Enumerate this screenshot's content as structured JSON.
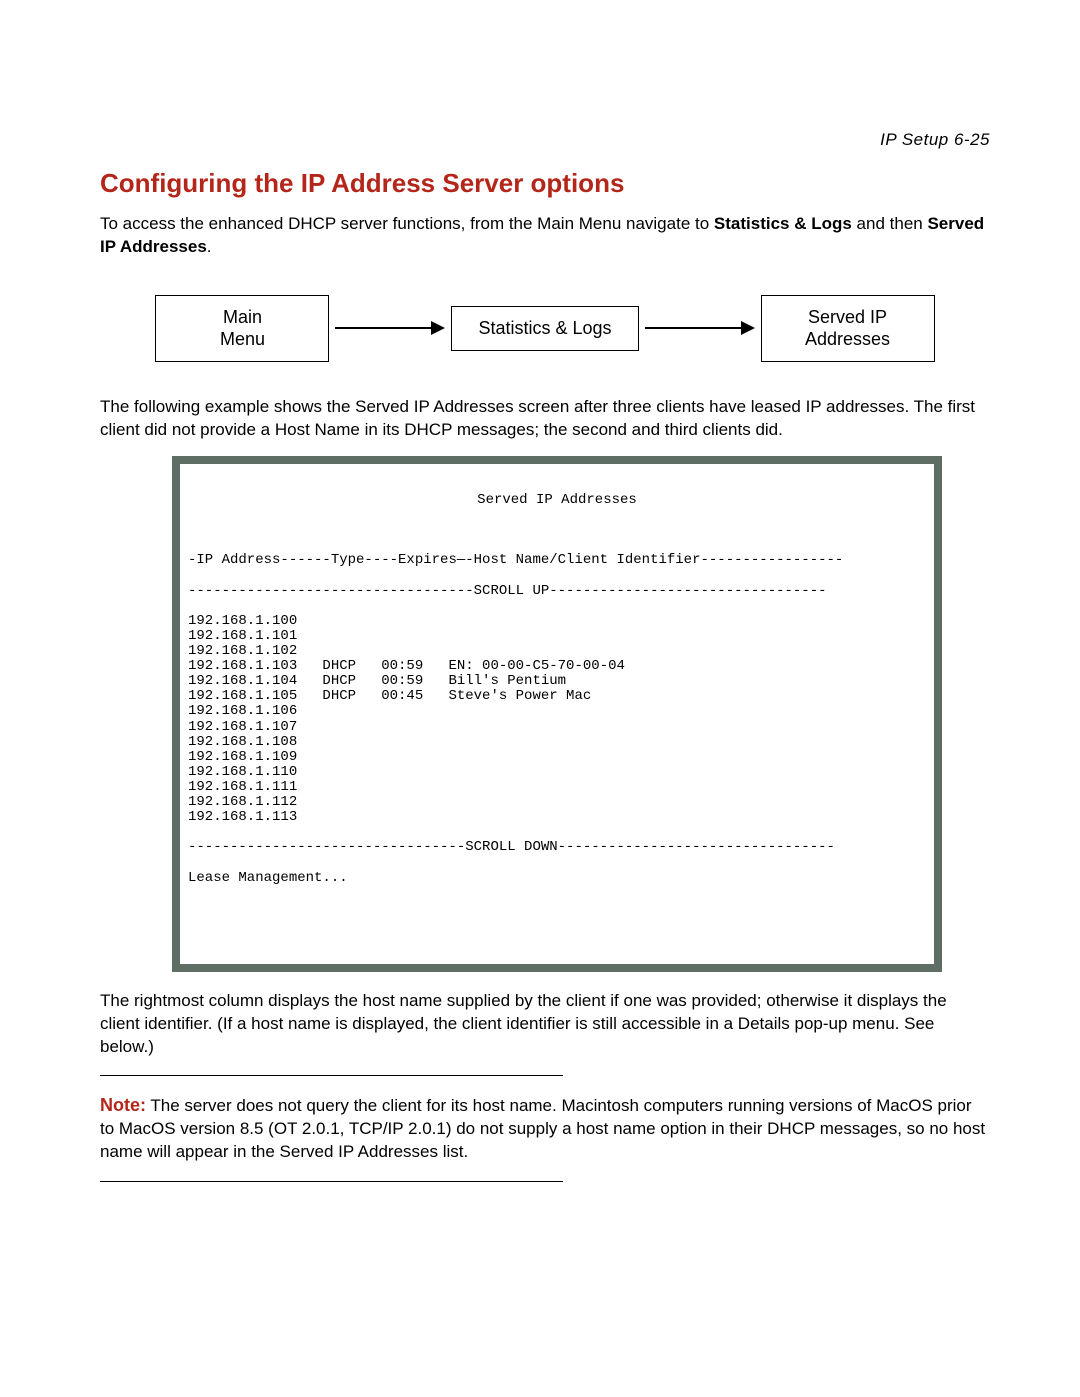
{
  "header": {
    "running_head": "IP Setup   6-25"
  },
  "title": "Configuring the IP Address Server options",
  "intro": {
    "pre": "To access the enhanced DHCP server functions, from the Main Menu navigate to ",
    "bold1": "Statistics & Logs",
    "mid": " and then ",
    "bold2": "Served IP Addresses",
    "post": "."
  },
  "breadcrumb": {
    "box1_line1": "Main",
    "box1_line2": "Menu",
    "box2": "Statistics & Logs",
    "box3_line1": "Served IP",
    "box3_line2": "Addresses"
  },
  "para_example": "The following example shows the Served IP Addresses screen after three clients have leased IP addresses. The first client did not provide a Host Name in its DHCP messages; the second and third clients did.",
  "terminal": {
    "title": "Served IP Addresses",
    "header_line": "-IP Address------Type----Expires—-Host Name/Client Identifier-----------------",
    "scroll_up": "----------------------------------SCROLL UP---------------------------------",
    "rows": [
      "192.168.1.100",
      "192.168.1.101",
      "192.168.1.102",
      "192.168.1.103   DHCP   00:59   EN: 00-00-C5-70-00-04",
      "192.168.1.104   DHCP   00:59   Bill's Pentium",
      "192.168.1.105   DHCP   00:45   Steve's Power Mac",
      "192.168.1.106",
      "192.168.1.107",
      "192.168.1.108",
      "192.168.1.109",
      "192.168.1.110",
      "192.168.1.111",
      "192.168.1.112",
      "192.168.1.113"
    ],
    "scroll_down": "---------------------------------SCROLL DOWN---------------------------------",
    "footer": "Lease Management..."
  },
  "para_rightmost": "The rightmost column displays the host name supplied by the client if one was provided; otherwise it displays the client identifier. (If a host name is displayed, the client identifier is still accessible in a Details pop-up menu. See below.)",
  "note": {
    "label": "Note:",
    "body": "  The server does not query the client for its host name. Macintosh computers running versions of MacOS prior to MacOS version 8.5 (OT 2.0.1, TCP/IP 2.0.1) do not supply a host name option in their DHCP messages, so no host name will appear in the Served IP Addresses list."
  }
}
